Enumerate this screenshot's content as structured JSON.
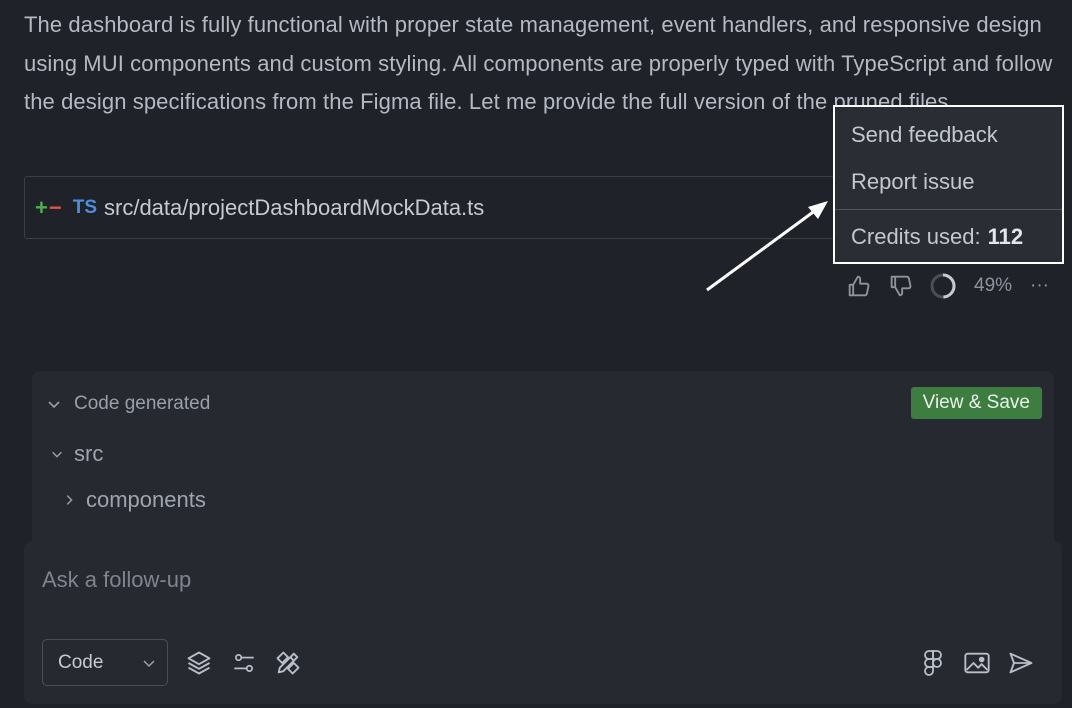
{
  "message": {
    "text": "The dashboard is fully functional with proper state management, event handlers, and responsive design using MUI components and custom styling. All components are properly typed with TypeScript and follow the design specifications from the Figma file. Let me provide the full version of the pruned files."
  },
  "file": {
    "diff_plus": "+",
    "diff_minus": "−",
    "lang_badge": "TS",
    "path": "src/data/projectDashboardMockData.ts"
  },
  "menu": {
    "send_feedback": "Send feedback",
    "report_issue": "Report issue",
    "credits_label": "Credits used:",
    "credits_value": "112"
  },
  "actions": {
    "thumbs_up_icon": "thumbs-up-icon",
    "thumbs_down_icon": "thumbs-down-icon",
    "progress_icon": "progress-ring-icon",
    "progress_fraction": 0.49,
    "percent": "49%",
    "more": "···"
  },
  "code_panel": {
    "title": "Code generated",
    "view_save": "View & Save",
    "tree": [
      {
        "label": "src",
        "expanded": true
      },
      {
        "label": "components",
        "expanded": false
      }
    ]
  },
  "composer": {
    "placeholder": "Ask a follow-up",
    "mode": "Code",
    "tools_left": [
      "layers-icon",
      "sliders-icon",
      "design-tools-icon"
    ],
    "tools_right": [
      "figma-icon",
      "image-icon",
      "send-icon"
    ]
  },
  "colors": {
    "background": "#1f2228",
    "panel": "#262930",
    "accent_green": "#3d7d3f",
    "ts_blue": "#4a8fe0",
    "diff_plus": "#4caf50",
    "diff_minus": "#e0524a"
  }
}
